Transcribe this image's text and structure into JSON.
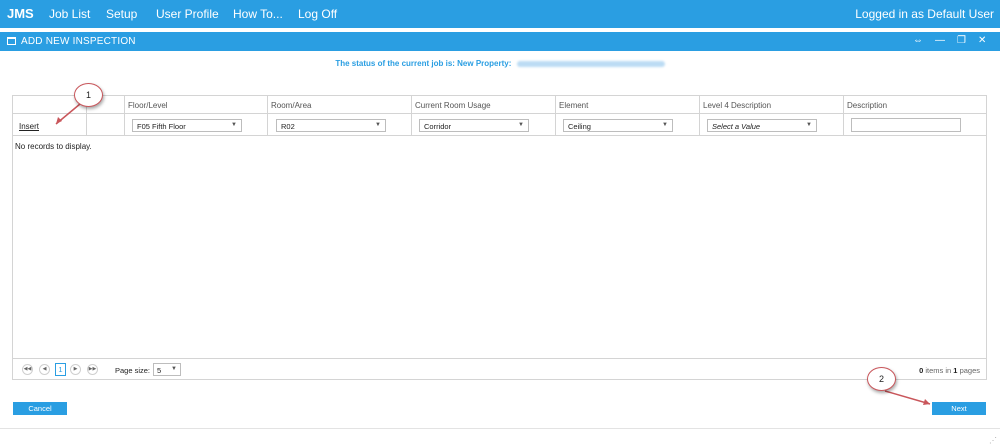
{
  "topbar": {
    "brand": "JMS",
    "nav": [
      "Job List",
      "Setup",
      "User Profile",
      "How To...",
      "Log Off"
    ],
    "user": "Logged in as Default User"
  },
  "window": {
    "title": "ADD NEW INSPECTION"
  },
  "status": {
    "text": "The status of the current job is: New   Property:"
  },
  "grid": {
    "headers": [
      "Floor/Level",
      "Room/Area",
      "Current Room Usage",
      "Element",
      "Level 4 Description",
      "Description"
    ],
    "insert_label": "Insert",
    "row_values": [
      "F05 Fifth Floor",
      "R02",
      "Corridor",
      "Ceiling",
      "Select a Value"
    ],
    "description_value": "",
    "empty_text": "No records to display."
  },
  "pager": {
    "current_page": "1",
    "page_size_label": "Page size:",
    "page_size": "5",
    "items_count": "0",
    "items_text": "items in",
    "pages_count": "1",
    "pages_text": "pages"
  },
  "buttons": {
    "cancel": "Cancel",
    "next": "Next"
  },
  "callouts": [
    "1",
    "2"
  ],
  "colors": {
    "accent": "#2a9ee2",
    "callout_border": "#c9565b"
  }
}
